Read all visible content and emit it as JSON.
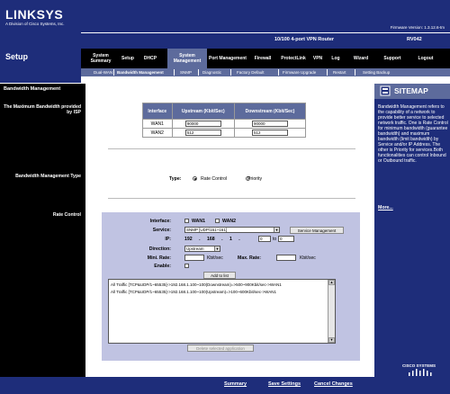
{
  "brand": {
    "logo": "LINKSYS",
    "tagline": "A Division of Cisco Systems, Inc.",
    "firmware": "Firmware Version: 1.3.12.6-tm"
  },
  "header": {
    "section": "Setup",
    "model_name": "10/100 4-port VPN Router",
    "model_number": "RV042"
  },
  "tabs": [
    {
      "label": "System Summary"
    },
    {
      "label": "Setup"
    },
    {
      "label": "DHCP"
    },
    {
      "label": "System Management"
    },
    {
      "label": "Port Management"
    },
    {
      "label": "Firewall"
    },
    {
      "label": "ProtectLink"
    },
    {
      "label": "VPN"
    },
    {
      "label": "Log"
    },
    {
      "label": "Wizard"
    },
    {
      "label": "Support"
    },
    {
      "label": "Logout"
    }
  ],
  "subtabs": [
    {
      "label": "Dual-WAN"
    },
    {
      "label": "Bandwidth Management"
    },
    {
      "label": "SNMP"
    },
    {
      "label": "Diagnostic"
    },
    {
      "label": "Factory Default"
    },
    {
      "label": "Firmware Upgrade"
    },
    {
      "label": "Restart"
    },
    {
      "label": "Setting Backup"
    }
  ],
  "left": {
    "title": "Bandwidth Management",
    "max_bw_label": "The Maximum Bandwidth provided by ISP",
    "type_label": "Bandwidth Management Type",
    "rate_label": "Rate Control"
  },
  "iface_table": {
    "headers": [
      "Interface",
      "Upstream (Kbit/Sec)",
      "Downstream (Kbit/Sec)"
    ],
    "rows": [
      {
        "iface": "WAN1",
        "up": "90000",
        "down": "90000"
      },
      {
        "iface": "WAN2",
        "up": "512",
        "down": "512"
      }
    ]
  },
  "type": {
    "label": "Type:",
    "option1": "Rate Control",
    "option2": "Priority",
    "selected": "Rate Control"
  },
  "rate_control": {
    "interface_label": "Interface:",
    "wan1": "WAN1",
    "wan2": "WAN2",
    "service_label": "Service:",
    "service_value": "SNMP [UDP/161~161]",
    "service_button": "Service Management",
    "ip_label": "IP:",
    "ip_prefix": "192 . 168 . 1 .",
    "ip_start": "0",
    "ip_to": "to",
    "ip_end": "0",
    "direction_label": "Direction:",
    "direction_value": "Upstream",
    "min_rate_label": "Mini. Rate:",
    "max_rate_label": "Max. Rate:",
    "unit1": "Kbit/sec",
    "unit2": "Kbit/sec",
    "enable_label": "Enable:",
    "add_button": "Add to list",
    "rules": [
      "All Traffic [TCP&UDP/1~65535]->192.168.1.100~100(Downstream)=>500~900Kbit/sec->WAN1",
      "All Traffic [TCP&UDP/1~65535]->192.168.1.100~100(Upstream)=>100~600Kbit/sec->WAN1"
    ],
    "delete_button": "Delete selected application"
  },
  "sitemap": {
    "title": "SITEMAP",
    "text": "Bandwidth Management refers to the capability of a network to provide better service to selected network traffic. One is Rate Control for minimum bandwidth (guarantee bandwidth) and maximum bandwidth (limit bandwidth) by Service and/or IP Address. The other is Priority for services.Both functionalities can control Inbound or Outbound traffic.",
    "more": "More...",
    "cisco": "CISCO SYSTEMS"
  },
  "footer": {
    "summary": "Summary",
    "save": "Save Settings",
    "cancel": "Cancel Changes"
  },
  "colors": {
    "navy": "#1e2d7a",
    "tab_active": "#5d6b9c",
    "panel": "#c0c3e2"
  }
}
